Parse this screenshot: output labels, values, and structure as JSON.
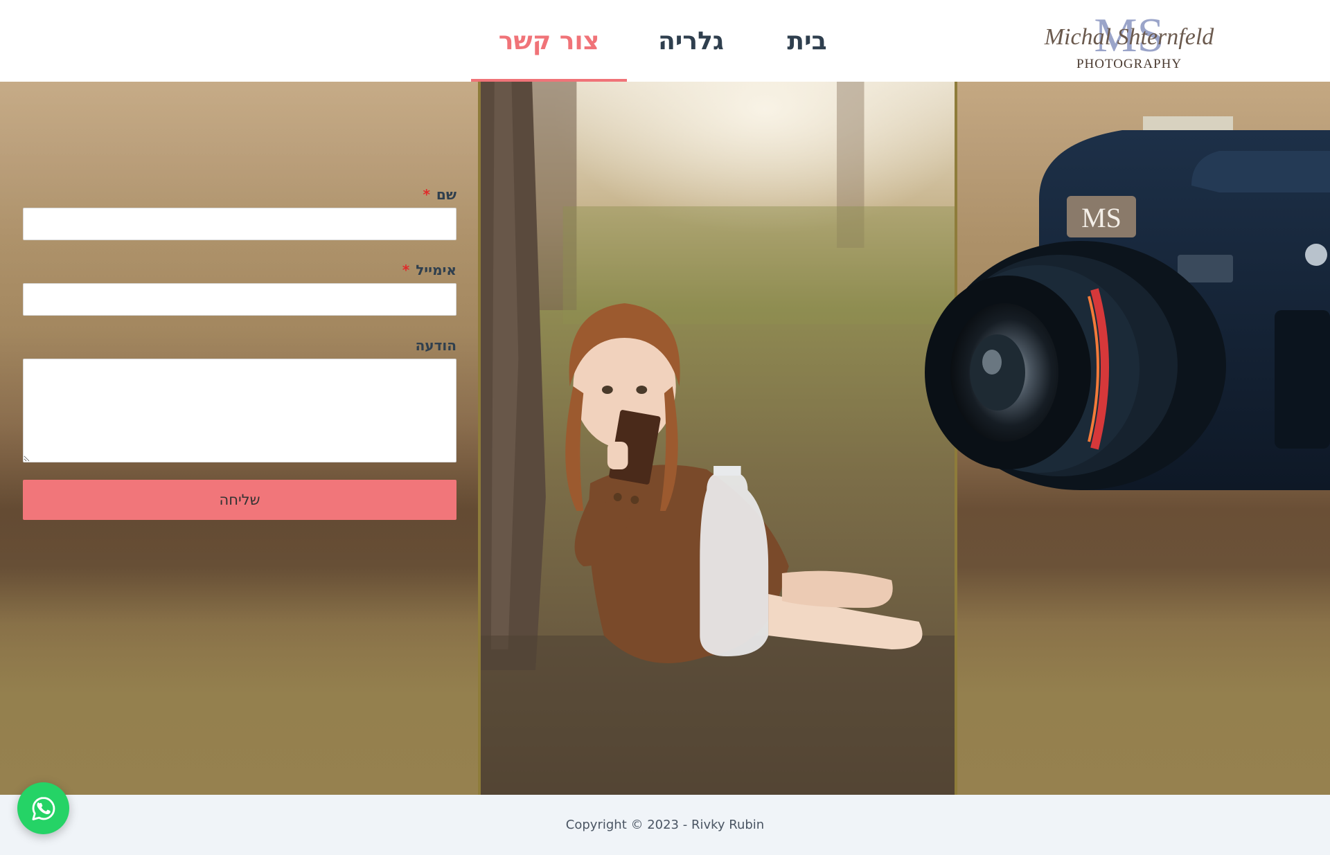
{
  "brand": {
    "logo_monogram": "MS",
    "logo_script": "Michal Shternfeld",
    "logo_sub": "PHOTOGRAPHY"
  },
  "nav": {
    "items": [
      {
        "label": "בית",
        "active": false
      },
      {
        "label": "גלריה",
        "active": false
      },
      {
        "label": "צור קשר",
        "active": true
      }
    ]
  },
  "form": {
    "name_label": "שם",
    "email_label": "אימייל",
    "message_label": "הודעה",
    "required_mark": "*",
    "name_value": "",
    "email_value": "",
    "message_value": "",
    "submit_label": "שליחה"
  },
  "camera_badge": "MS",
  "footer": {
    "copyright": "Copyright © 2023 - Rivky Rubin"
  },
  "colors": {
    "accent": "#f07378",
    "nav_text": "#2f3f4e",
    "submit_bg": "#f1767a",
    "whatsapp": "#25d366",
    "footer_bg": "#f0f4f8"
  },
  "icons": {
    "whatsapp": "whatsapp-icon",
    "resize": "resize-handle-icon"
  }
}
